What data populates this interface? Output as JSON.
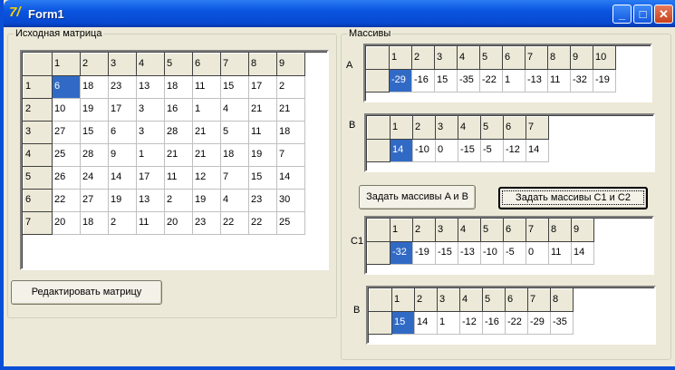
{
  "window": {
    "title": "Form1",
    "icon": "delphi-app-icon"
  },
  "matrix_group": {
    "label": "Исходная матрица",
    "col_headers": [
      "1",
      "2",
      "3",
      "4",
      "5",
      "6",
      "7",
      "8",
      "9"
    ],
    "row_headers": [
      "1",
      "2",
      "3",
      "4",
      "5",
      "6",
      "7"
    ],
    "rows": [
      [
        6,
        18,
        23,
        13,
        18,
        11,
        15,
        17,
        2
      ],
      [
        10,
        19,
        17,
        3,
        16,
        1,
        4,
        21,
        21
      ],
      [
        27,
        15,
        6,
        3,
        28,
        21,
        5,
        11,
        18
      ],
      [
        25,
        28,
        9,
        1,
        21,
        21,
        18,
        19,
        7
      ],
      [
        26,
        24,
        14,
        17,
        11,
        12,
        7,
        15,
        14
      ],
      [
        22,
        27,
        19,
        13,
        2,
        19,
        4,
        23,
        30
      ],
      [
        20,
        18,
        2,
        11,
        20,
        23,
        22,
        22,
        25
      ]
    ]
  },
  "edit_button": "Редактировать матрицу",
  "arrays_group": {
    "label": "Массивы",
    "arrays": [
      {
        "label": "A",
        "values": [
          -29,
          -16,
          15,
          -35,
          -22,
          1,
          -13,
          11,
          -32,
          -19
        ]
      },
      {
        "label": "B",
        "values": [
          14,
          -10,
          0,
          -15,
          -5,
          -12,
          14
        ]
      },
      {
        "label": "C1",
        "values": [
          -32,
          -19,
          -15,
          -13,
          -10,
          -5,
          0,
          11,
          14
        ]
      },
      {
        "label": "B",
        "values": [
          15,
          14,
          1,
          -12,
          -16,
          -22,
          -29,
          -35
        ]
      }
    ],
    "set_ab_button": "Задать массивы A и B",
    "set_c_button": "Задать массивы C1 и C2"
  }
}
